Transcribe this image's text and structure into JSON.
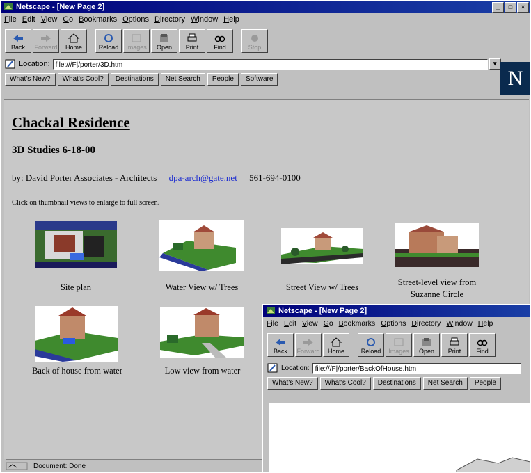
{
  "main_window": {
    "title": "Netscape - [New Page 2]",
    "menu": [
      "File",
      "Edit",
      "View",
      "Go",
      "Bookmarks",
      "Options",
      "Directory",
      "Window",
      "Help"
    ],
    "toolbar": [
      {
        "label": "Back",
        "icon": "back-arrow-icon",
        "enabled": true
      },
      {
        "label": "Forward",
        "icon": "forward-arrow-icon",
        "enabled": false
      },
      {
        "label": "Home",
        "icon": "home-icon",
        "enabled": true
      },
      {
        "label": "Reload",
        "icon": "reload-icon",
        "enabled": true
      },
      {
        "label": "Images",
        "icon": "images-icon",
        "enabled": false
      },
      {
        "label": "Open",
        "icon": "open-icon",
        "enabled": true
      },
      {
        "label": "Print",
        "icon": "print-icon",
        "enabled": true
      },
      {
        "label": "Find",
        "icon": "find-icon",
        "enabled": true
      },
      {
        "label": "Stop",
        "icon": "stop-icon",
        "enabled": false
      }
    ],
    "location_label": "Location:",
    "location_url": "file:///F|/porter/3D.htm",
    "directory_buttons": [
      "What's New?",
      "What's Cool?",
      "Destinations",
      "Net Search",
      "People",
      "Software"
    ],
    "logo_letter": "N",
    "status": "Document: Done"
  },
  "page": {
    "title": "Chackal Residence",
    "subtitle": "3D Studies 6-18-00",
    "byline": "by: David Porter Associates - Architects",
    "email": "dpa-arch@gate.net",
    "phone": "561-694-0100",
    "instruction": "Click on thumbnail views to enlarge to full screen.",
    "thumbnails": [
      {
        "caption": "Site plan"
      },
      {
        "caption": "Water View w/ Trees"
      },
      {
        "caption": "Street View w/ Trees"
      },
      {
        "caption": "Street-level view from Suzanne Circle"
      },
      {
        "caption": "Back of house from water"
      },
      {
        "caption": "Low view from water"
      }
    ]
  },
  "popup_window": {
    "title": "Netscape - [New Page 2]",
    "menu": [
      "File",
      "Edit",
      "View",
      "Go",
      "Bookmarks",
      "Options",
      "Directory",
      "Window",
      "Help"
    ],
    "toolbar": [
      {
        "label": "Back",
        "enabled": true
      },
      {
        "label": "Forward",
        "enabled": false
      },
      {
        "label": "Home",
        "enabled": true
      },
      {
        "label": "Reload",
        "enabled": true
      },
      {
        "label": "Images",
        "enabled": false
      },
      {
        "label": "Open",
        "enabled": true
      },
      {
        "label": "Print",
        "enabled": true
      },
      {
        "label": "Find",
        "enabled": true
      }
    ],
    "location_label": "Location:",
    "location_url": "file:///F|/porter/BackOfHouse.htm",
    "directory_buttons": [
      "What's New?",
      "What's Cool?",
      "Destinations",
      "Net Search",
      "People"
    ]
  }
}
